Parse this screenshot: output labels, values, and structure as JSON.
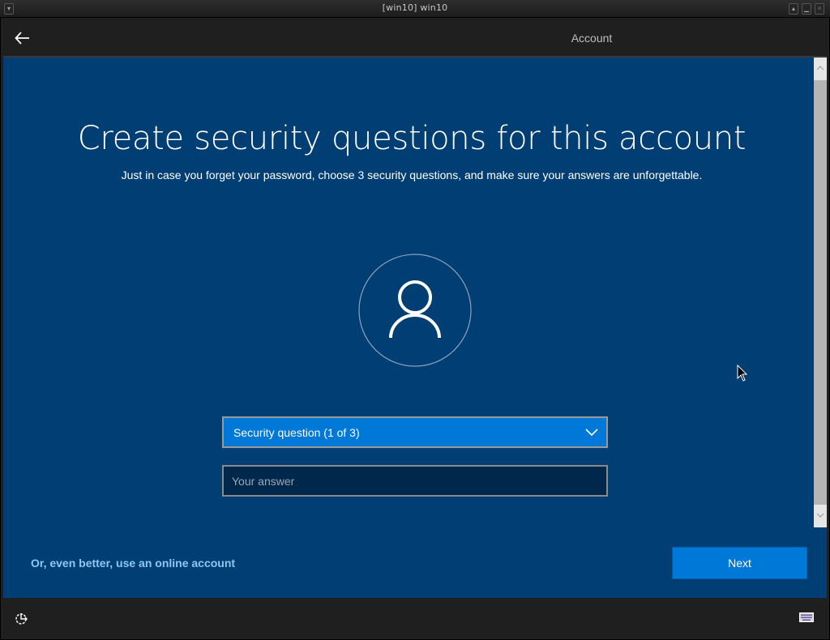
{
  "window": {
    "title": "[win10] win10",
    "buttons": [
      "menu",
      "shade",
      "minimize",
      "close"
    ]
  },
  "topbar": {
    "back_icon": "back-arrow-icon",
    "active_tab": "Account"
  },
  "page": {
    "heading": "Create security questions for this account",
    "subheading": "Just in case you forget your password, choose 3 security questions, and make sure your answers are unforgettable.",
    "avatar_icon": "user-icon"
  },
  "form": {
    "question_select": {
      "selected": "Security question (1 of 3)",
      "icon": "chevron-down-icon"
    },
    "answer_field": {
      "value": "",
      "placeholder": "Your answer"
    }
  },
  "footer": {
    "online_account_link": "Or, even better, use an online account",
    "next_label": "Next"
  },
  "bottombar": {
    "left_icon": "ease-of-access-icon",
    "right_icon": "keyboard-icon"
  },
  "colors": {
    "background": "#003e73",
    "accent": "#0078d7",
    "link": "#8ec8f2",
    "chrome": "#1f1f1f"
  }
}
